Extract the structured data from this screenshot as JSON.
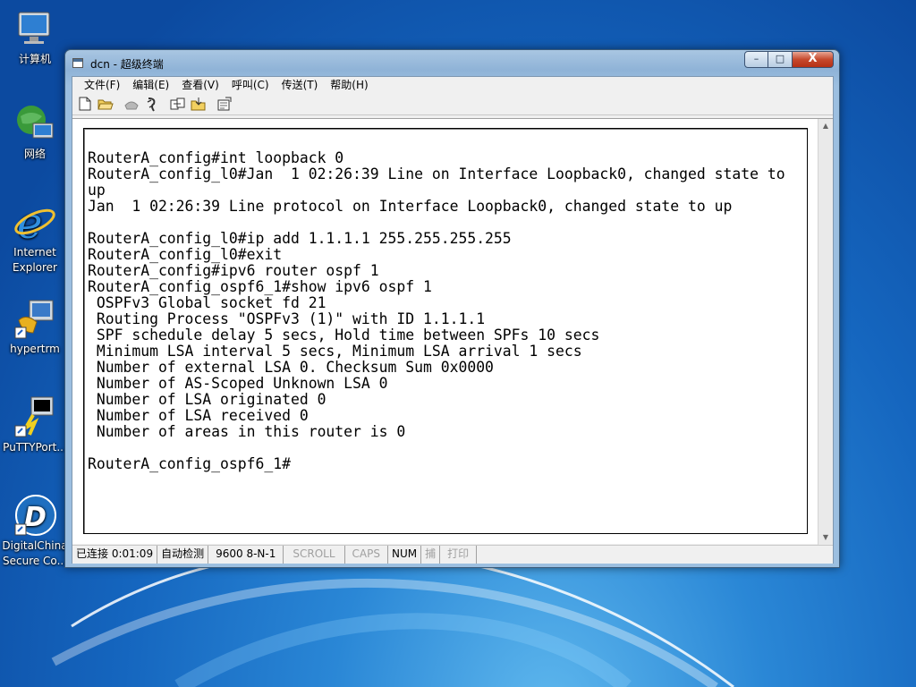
{
  "desktop": {
    "icons": [
      {
        "label": "计算机"
      },
      {
        "label": "网络"
      },
      {
        "label": "Internet\nExplorer"
      },
      {
        "label": "hypertrm"
      },
      {
        "label": "PuTTYPort..."
      },
      {
        "label": "DigitalChina\nSecure Co..."
      }
    ]
  },
  "window": {
    "title": "dcn - 超级终端",
    "buttons": {
      "minimize": "–",
      "maximize": "□",
      "close": "X"
    }
  },
  "menu": [
    "文件(F)",
    "编辑(E)",
    "查看(V)",
    "呼叫(C)",
    "传送(T)",
    "帮助(H)"
  ],
  "toolbar_icons": [
    "new-icon",
    "open-icon",
    "phone-icon",
    "disconnect-icon",
    "send-icon",
    "receive-icon",
    "properties-icon"
  ],
  "terminal": {
    "text": "RouterA_config#int loopback 0\nRouterA_config_l0#Jan  1 02:26:39 Line on Interface Loopback0, changed state to\nup\nJan  1 02:26:39 Line protocol on Interface Loopback0, changed state to up\n\nRouterA_config_l0#ip add 1.1.1.1 255.255.255.255\nRouterA_config_l0#exit\nRouterA_config#ipv6 router ospf 1\nRouterA_config_ospf6_1#show ipv6 ospf 1\n OSPFv3 Global socket fd 21\n Routing Process \"OSPFv3 (1)\" with ID 1.1.1.1\n SPF schedule delay 5 secs, Hold time between SPFs 10 secs\n Minimum LSA interval 5 secs, Minimum LSA arrival 1 secs\n Number of external LSA 0. Checksum Sum 0x0000\n Number of AS-Scoped Unknown LSA 0\n Number of LSA originated 0\n Number of LSA received 0\n Number of areas in this router is 0\n\nRouterA_config_ospf6_1#"
  },
  "status": {
    "connected": "已连接 0:01:09",
    "detect": "自动检测",
    "settings": "9600 8-N-1",
    "scroll": "SCROLL",
    "caps": "CAPS",
    "num": "NUM",
    "capture": "捕",
    "print": "打印"
  }
}
